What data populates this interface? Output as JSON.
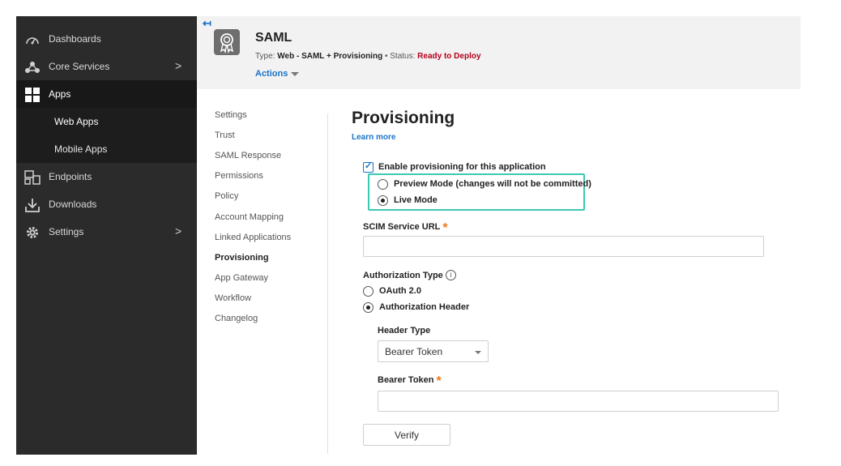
{
  "sidebar": {
    "items": [
      {
        "label": "Dashboards",
        "icon": "dashboard-gauge-icon"
      },
      {
        "label": "Core Services",
        "icon": "core-services-icon",
        "chevron": ">"
      },
      {
        "label": "Apps",
        "icon": "apps-grid-icon"
      },
      {
        "label": "Web Apps"
      },
      {
        "label": "Mobile Apps"
      },
      {
        "label": "Endpoints",
        "icon": "endpoints-icon"
      },
      {
        "label": "Downloads",
        "icon": "download-icon"
      },
      {
        "label": "Settings",
        "icon": "gear-icon",
        "chevron": ">"
      }
    ]
  },
  "header": {
    "back": "↤",
    "title": "SAML",
    "type_label": "Type:",
    "type_value": "Web - SAML + Provisioning",
    "separator": "•",
    "status_label": "Status:",
    "status_value": "Ready to Deploy",
    "actions": "Actions"
  },
  "settings_menu": [
    "Settings",
    "Trust",
    "SAML Response",
    "Permissions",
    "Policy",
    "Account Mapping",
    "Linked Applications",
    "Provisioning",
    "App Gateway",
    "Workflow",
    "Changelog"
  ],
  "main": {
    "title": "Provisioning",
    "learn_more": "Learn more",
    "enable_label": "Enable provisioning for this application",
    "preview_mode": "Preview Mode (changes will not be committed)",
    "live_mode": "Live Mode",
    "scim_label": "SCIM Service URL",
    "scim_value": "",
    "required_mark": "*",
    "auth_type_label": "Authorization Type",
    "info_glyph": "i",
    "oauth_label": "OAuth 2.0",
    "auth_header_label": "Authorization Header",
    "header_type_label": "Header Type",
    "header_type_value": "Bearer Token",
    "bearer_token_label": "Bearer Token",
    "bearer_token_value": "",
    "verify_button": "Verify"
  },
  "colors": {
    "sidebar_bg": "#2b2b2b",
    "link_blue": "#1a73c8",
    "status_red": "#b3001b",
    "required_orange": "#f07a1a",
    "highlight_teal": "#3cc9b2"
  }
}
